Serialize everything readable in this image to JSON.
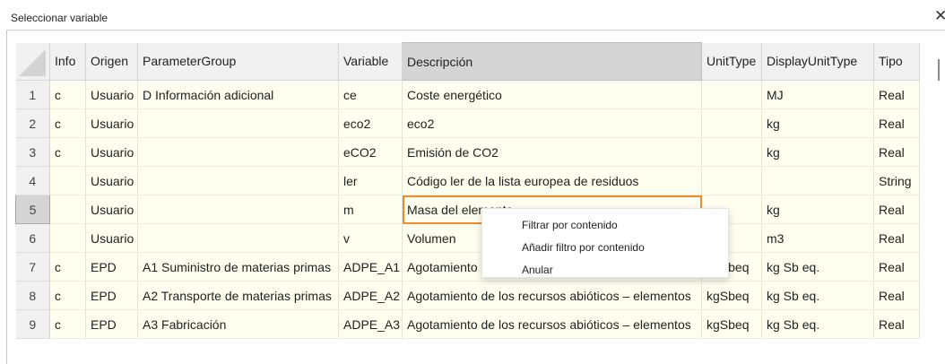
{
  "window": {
    "title": "Seleccionar variable",
    "close_glyph": "✕"
  },
  "table": {
    "headers": {
      "info": "Info",
      "origen": "Origen",
      "group": "ParameterGroup",
      "variable": "Variable",
      "descripcion": "Descripción",
      "unittype": "UnitType",
      "displayunit": "DisplayUnitType",
      "tipo": "Tipo"
    },
    "sorted_column": "Descripción",
    "selected_row": 5,
    "rows": [
      {
        "n": "1",
        "info": "c",
        "origen": "Usuario",
        "group": "D Información adicional",
        "variable": "ce",
        "descripcion": "Coste energético",
        "unittype": "",
        "displayunit": "MJ",
        "tipo": "Real"
      },
      {
        "n": "2",
        "info": "c",
        "origen": "Usuario",
        "group": "",
        "variable": "eco2",
        "descripcion": "eco2",
        "unittype": "",
        "displayunit": "kg",
        "tipo": "Real"
      },
      {
        "n": "3",
        "info": "c",
        "origen": "Usuario",
        "group": "",
        "variable": "eCO2",
        "descripcion": "Emisión de CO2",
        "unittype": "",
        "displayunit": "kg",
        "tipo": "Real"
      },
      {
        "n": "4",
        "info": "",
        "origen": "Usuario",
        "group": "",
        "variable": "ler",
        "descripcion": "Código ler de la lista europea de residuos",
        "unittype": "",
        "displayunit": "",
        "tipo": "String"
      },
      {
        "n": "5",
        "info": "",
        "origen": "Usuario",
        "group": "",
        "variable": "m",
        "descripcion": "Masa del elemento",
        "unittype": "",
        "displayunit": "kg",
        "tipo": "Real"
      },
      {
        "n": "6",
        "info": "",
        "origen": "Usuario",
        "group": "",
        "variable": "v",
        "descripcion": "Volumen",
        "unittype": "",
        "displayunit": "m3",
        "tipo": "Real"
      },
      {
        "n": "7",
        "info": "c",
        "origen": "EPD",
        "group": "A1 Suministro de materias primas",
        "variable": "ADPE_A1",
        "descripcion": "Agotamiento de los recursos abióticos – elementos",
        "unittype": "kgSbeq",
        "displayunit": "kg Sb eq.",
        "tipo": "Real"
      },
      {
        "n": "8",
        "info": "c",
        "origen": "EPD",
        "group": "A2 Transporte de materias primas",
        "variable": "ADPE_A2",
        "descripcion": "Agotamiento de los recursos abióticos – elementos",
        "unittype": "kgSbeq",
        "displayunit": "kg Sb eq.",
        "tipo": "Real"
      },
      {
        "n": "9",
        "info": "c",
        "origen": "EPD",
        "group": "A3 Fabricación",
        "variable": "ADPE_A3",
        "descripcion": "Agotamiento de los recursos abióticos – elementos",
        "unittype": "kgSbeq",
        "displayunit": "kg Sb eq.",
        "tipo": "Real"
      }
    ]
  },
  "context_menu": {
    "items": [
      "Filtrar por contenido",
      "Añadir filtro por contenido",
      "Anular"
    ]
  },
  "colors": {
    "row_background": "#fffff0",
    "header_background": "#f1f1f1",
    "sorted_header_background": "#d5d5d5",
    "focus_outline": "#f08a2b"
  }
}
